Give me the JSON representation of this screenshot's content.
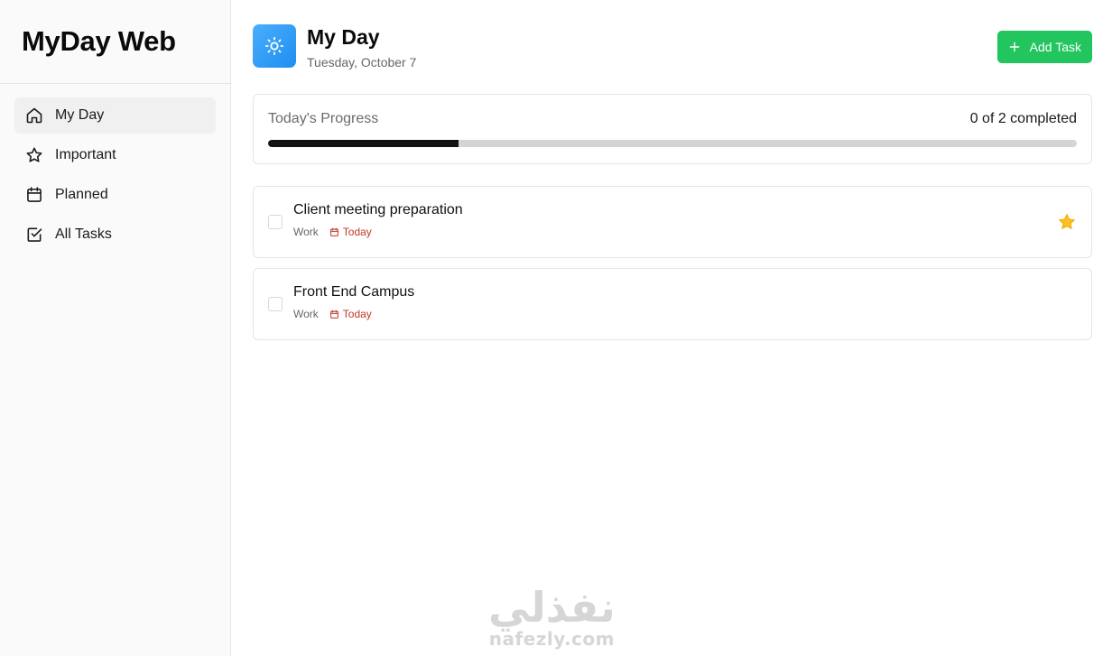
{
  "brand": {
    "title": "MyDay Web"
  },
  "sidebar": {
    "items": [
      {
        "label": "My Day",
        "icon": "home-icon",
        "active": true
      },
      {
        "label": "Important",
        "icon": "star-outline-icon",
        "active": false
      },
      {
        "label": "Planned",
        "icon": "calendar-icon",
        "active": false
      },
      {
        "label": "All Tasks",
        "icon": "check-square-icon",
        "active": false
      }
    ]
  },
  "header": {
    "icon": "sun-icon",
    "title": "My Day",
    "date": "Tuesday, October 7",
    "add_label": "Add Task"
  },
  "progress": {
    "label": "Today's Progress",
    "count_text": "0 of 2 completed",
    "fill_fraction": 0.235
  },
  "tasks": [
    {
      "title": "Client meeting preparation",
      "category": "Work",
      "due": "Today",
      "important": true,
      "completed": false
    },
    {
      "title": "Front End Campus",
      "category": "Work",
      "due": "Today",
      "important": false,
      "completed": false
    }
  ],
  "watermark": {
    "arabic": "نفذلي",
    "latin": "nafezly.com"
  },
  "colors": {
    "accent_green": "#22c55e",
    "sun_blue": "#1f8ef1",
    "star_yellow": "#fbbf24",
    "due_red": "#c0392b"
  }
}
